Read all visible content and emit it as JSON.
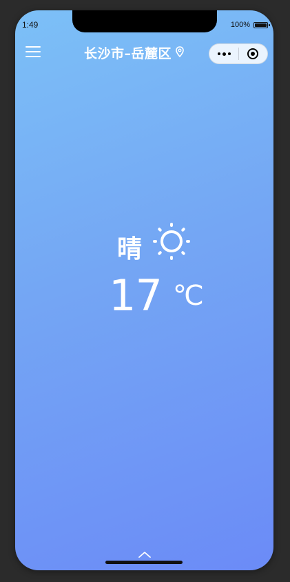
{
  "status_bar": {
    "time": "1:49",
    "battery_text": "100%"
  },
  "nav": {
    "menu_icon": "menu-icon",
    "title": "长沙市–岳麓区",
    "location_icon": "location-pin-icon",
    "capsule": {
      "more_icon": "more-dots-icon",
      "close_icon": "target-close-icon"
    }
  },
  "weather": {
    "condition": "晴",
    "condition_icon": "sun-icon",
    "temperature": "17",
    "unit": "℃"
  },
  "bottom": {
    "expand_icon": "chevron-up-icon"
  },
  "colors": {
    "gradient_top": "#7cc0f7",
    "gradient_bottom": "#6b8bf7",
    "text": "#ffffff"
  }
}
